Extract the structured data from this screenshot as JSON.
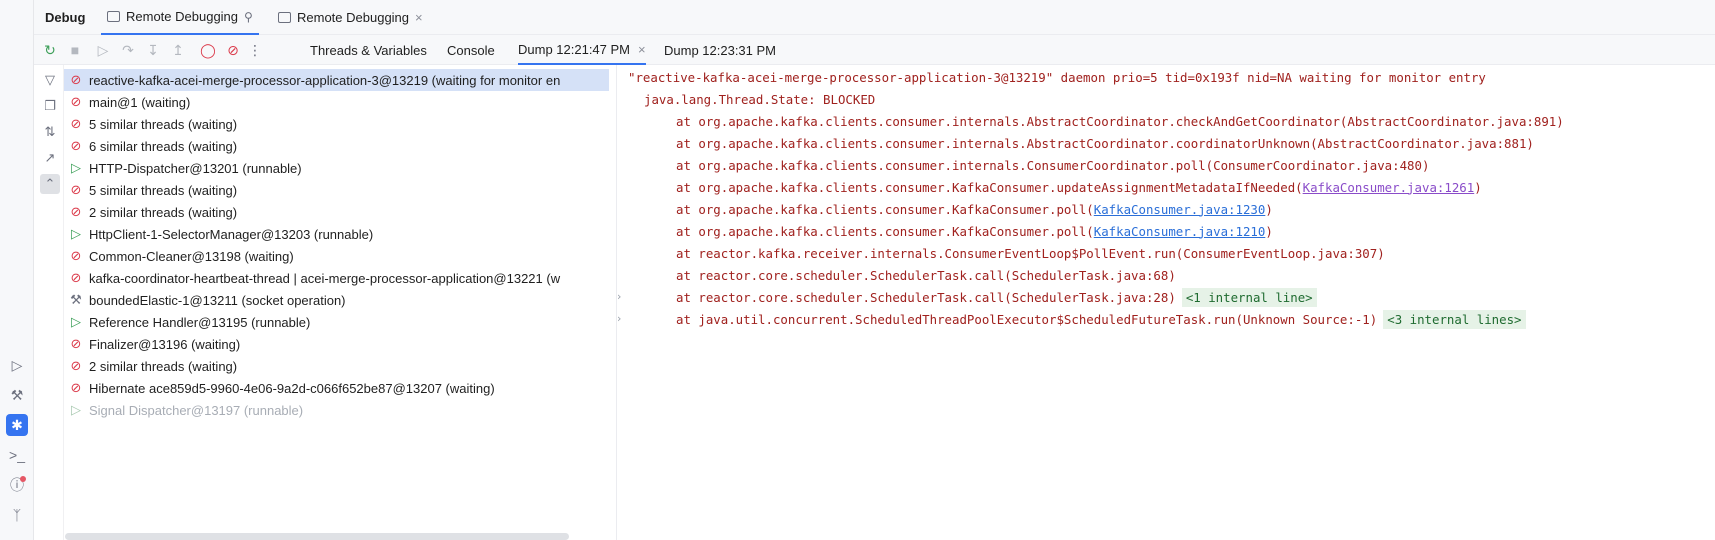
{
  "header": {
    "tool_title": "Debug",
    "tabs": [
      {
        "label": "Remote Debugging",
        "active": true
      },
      {
        "label": "Remote Debugging",
        "active": false
      }
    ]
  },
  "toolbar": {
    "tabs": [
      {
        "label": "Threads & Variables"
      },
      {
        "label": "Console"
      },
      {
        "label": "Dump 12:21:47 PM",
        "active": true
      },
      {
        "label": "Dump 12:23:31 PM"
      }
    ]
  },
  "threads": [
    {
      "label": "reactive-kafka-acei-merge-processor-application-3@13219 (waiting for monitor en",
      "state": "waiting",
      "selected": true
    },
    {
      "label": "main@1 (waiting)",
      "state": "waiting"
    },
    {
      "label": "5 similar threads (waiting)",
      "state": "waiting"
    },
    {
      "label": "6 similar threads (waiting)",
      "state": "waiting"
    },
    {
      "label": "HTTP-Dispatcher@13201 (runnable)",
      "state": "runnable"
    },
    {
      "label": "5 similar threads (waiting)",
      "state": "waiting"
    },
    {
      "label": "2 similar threads (waiting)",
      "state": "waiting"
    },
    {
      "label": "HttpClient-1-SelectorManager@13203 (runnable)",
      "state": "runnable"
    },
    {
      "label": "Common-Cleaner@13198 (waiting)",
      "state": "waiting"
    },
    {
      "label": "kafka-coordinator-heartbeat-thread | acei-merge-processor-application@13221 (w",
      "state": "waiting"
    },
    {
      "label": "boundedElastic-1@13211 (socket operation)",
      "state": "socket"
    },
    {
      "label": "Reference Handler@13195 (runnable)",
      "state": "runnable"
    },
    {
      "label": "Finalizer@13196 (waiting)",
      "state": "waiting"
    },
    {
      "label": "2 similar threads (waiting)",
      "state": "waiting"
    },
    {
      "label": "Hibernate ace859d5-9960-4e06-9a2d-c066f652be87@13207 (waiting)",
      "state": "waiting"
    },
    {
      "label": "Signal Dispatcher@13197 (runnable)",
      "state": "runnable",
      "dim": true
    }
  ],
  "trace": {
    "header": "\"reactive-kafka-acei-merge-processor-application-3@13219\" daemon prio=5 tid=0x193f nid=NA waiting for monitor entry",
    "state_line": "java.lang.Thread.State: BLOCKED",
    "frames": [
      {
        "text": "at org.apache.kafka.clients.consumer.internals.AbstractCoordinator.checkAndGetCoordinator(AbstractCoordinator.java:891)"
      },
      {
        "text": "at org.apache.kafka.clients.consumer.internals.AbstractCoordinator.coordinatorUnknown(AbstractCoordinator.java:881)"
      },
      {
        "text": "at org.apache.kafka.clients.consumer.internals.ConsumerCoordinator.poll(ConsumerCoordinator.java:480)"
      },
      {
        "pre": "at org.apache.kafka.clients.consumer.KafkaConsumer.updateAssignmentMetadataIfNeeded(",
        "link": "KafkaConsumer.java:1261",
        "post": ")",
        "visited": true
      },
      {
        "pre": "at org.apache.kafka.clients.consumer.KafkaConsumer.poll(",
        "link": "KafkaConsumer.java:1230",
        "post": ")"
      },
      {
        "pre": "at org.apache.kafka.clients.consumer.KafkaConsumer.poll(",
        "link": "KafkaConsumer.java:1210",
        "post": ")"
      },
      {
        "text": "at reactor.kafka.receiver.internals.ConsumerEventLoop$PollEvent.run(ConsumerEventLoop.java:307)"
      },
      {
        "text": "at reactor.core.scheduler.SchedulerTask.call(SchedulerTask.java:68)"
      },
      {
        "text": "at reactor.core.scheduler.SchedulerTask.call(SchedulerTask.java:28)",
        "fold": "<1 internal line>"
      },
      {
        "text": "at java.util.concurrent.ScheduledThreadPoolExecutor$ScheduledFutureTask.run(Unknown Source:-1)",
        "fold": "<3 internal lines>"
      }
    ]
  },
  "colors": {
    "accent": "#3574f0",
    "selection": "#d5e1f7",
    "trace_text": "#a0211e",
    "link": "#2b6fd8",
    "fold_bg": "#e6f2e7"
  }
}
